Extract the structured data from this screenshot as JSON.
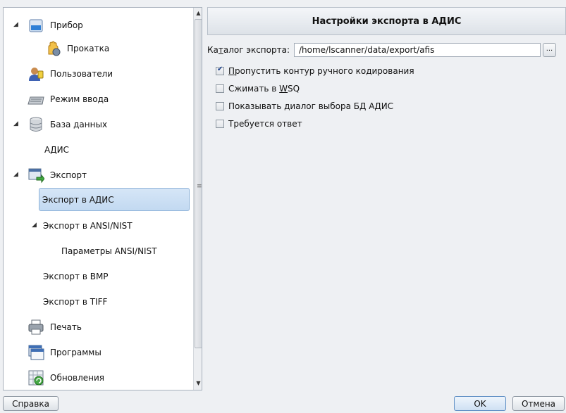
{
  "tree": {
    "items": [
      {
        "label": "Прибор",
        "icon": "device-icon",
        "expander": "◢"
      },
      {
        "label": "Прокатка",
        "icon": "hand-roll-icon"
      },
      {
        "label": "Пользователи",
        "icon": "users-icon"
      },
      {
        "label": "Режим ввода",
        "icon": "keyboard-icon"
      },
      {
        "label": "База данных",
        "icon": "database-icon",
        "expander": "◢"
      },
      {
        "label": "АДИС"
      },
      {
        "label": "Экспорт",
        "icon": "export-icon",
        "expander": "◢"
      },
      {
        "label": "Экспорт в АДИС",
        "selected": true
      },
      {
        "label": "Экспорт в ANSI/NIST",
        "expander": "◢"
      },
      {
        "label": "Параметры ANSI/NIST"
      },
      {
        "label": "Экспорт в BMP"
      },
      {
        "label": "Экспорт в TIFF"
      },
      {
        "label": "Печать",
        "icon": "printer-icon"
      },
      {
        "label": "Программы",
        "icon": "programs-icon"
      },
      {
        "label": "Обновления",
        "icon": "updates-icon"
      }
    ],
    "scroll_up": "▲",
    "scroll_down": "▼",
    "scroll_grip": "≡"
  },
  "settings": {
    "title": "Настройки экспорта в АДИС",
    "export_dir": {
      "label_before": "Ка",
      "label_underlined": "т",
      "label_after": "алог экспорта:",
      "value": "/home/lscanner/data/export/afis",
      "browse_label": "..."
    },
    "options": [
      {
        "mnemonic": "П",
        "text": "ропустить контур ручного кодирования",
        "checked": true
      },
      {
        "prefix": "Сжимать в ",
        "mnemonic": "W",
        "text": "SQ",
        "checked": false
      },
      {
        "text": "Показывать диалог выбора БД АДИС",
        "checked": false
      },
      {
        "text": "Требуется ответ",
        "checked": false
      }
    ]
  },
  "footer": {
    "help_label": "Справка",
    "ok_label": "OK",
    "cancel_label": "Отмена"
  },
  "colors": {
    "selection": "#c2d9f1",
    "header_bg": "#dde2e8",
    "window_bg": "#eef0f3"
  }
}
